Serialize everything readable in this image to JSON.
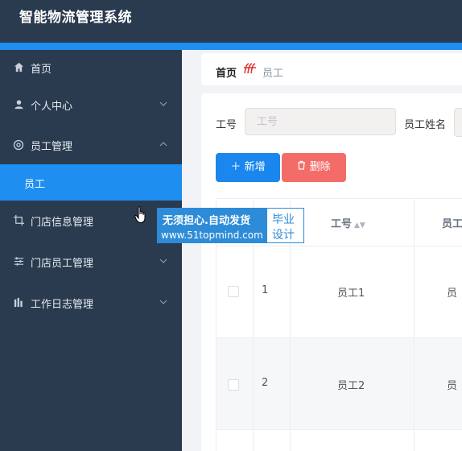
{
  "app": {
    "title": "智能物流管理系统"
  },
  "sidebar": {
    "items": [
      {
        "label": "首页",
        "icon": "home-icon"
      },
      {
        "label": "个人中心",
        "icon": "user-icon",
        "chevron": "⌄"
      },
      {
        "label": "员工管理",
        "icon": "settings-icon",
        "chevron": "⌃"
      },
      {
        "label": "员工",
        "active": true
      },
      {
        "label": "门店信息管理",
        "icon": "crop-icon",
        "chevron": "⌄"
      },
      {
        "label": "门店员工管理",
        "icon": "sliders-icon",
        "chevron": "⌄"
      },
      {
        "label": "工作日志管理",
        "icon": "bar-chart-icon",
        "chevron": "⌄"
      }
    ]
  },
  "breadcrumb": {
    "home": "首页",
    "current": "员工"
  },
  "search": {
    "employee_no_label": "工号",
    "employee_no_placeholder": "工号",
    "employee_name_label": "员工姓名"
  },
  "toolbar": {
    "add_label": "新增",
    "delete_label": "删除"
  },
  "table": {
    "headers": {
      "employee_no": "工号",
      "employee_name": "员工"
    },
    "rows": [
      {
        "index": "1",
        "employee_no": "员工1",
        "extra": "员"
      },
      {
        "index": "2",
        "employee_no": "员工2",
        "extra": "员"
      }
    ]
  },
  "watermark": {
    "line1": "无须担心.自动发货",
    "line2": "www.51topmind.com",
    "tag1": "毕业",
    "tag2": "设计"
  },
  "colors": {
    "sidebar_bg": "#2a3b4f",
    "accent": "#1f8ef1",
    "danger": "#f46c67"
  }
}
